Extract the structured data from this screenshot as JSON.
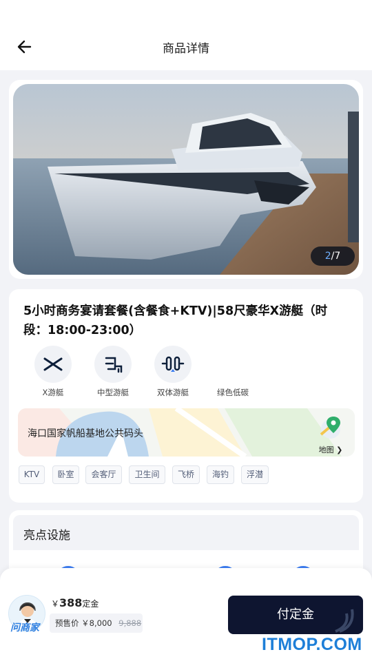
{
  "header": {
    "title": "商品详情",
    "back_icon": "arrow-left-icon"
  },
  "gallery": {
    "current": "2",
    "separator": "/",
    "total": "7"
  },
  "product": {
    "title": "5小时商务宴请套餐(含餐食+KTV)|58尺豪华X游艇（时段：18:00-23:00）",
    "features": [
      {
        "icon": "x-logo-icon",
        "label": "X游艇"
      },
      {
        "icon": "mid-yacht-icon",
        "label": "中型游艇"
      },
      {
        "icon": "twin-hull-icon",
        "label": "双体游艇"
      },
      {
        "icon": "",
        "label": "绿色低碳"
      }
    ],
    "location": {
      "text": "海口国家帆船基地公共码头",
      "map_label": "地图 ❯"
    },
    "tags": [
      "KTV",
      "卧室",
      "会客厅",
      "卫生间",
      "飞桥",
      "海钓",
      "浮潜"
    ]
  },
  "highlights": {
    "title": "亮点设施"
  },
  "footer": {
    "ask_label": "问商家",
    "deposit_currency": "￥",
    "deposit_amount": "388",
    "deposit_unit": "定金",
    "presale_label": "预售价",
    "presale_price": "￥8,000",
    "original_price": "9,888",
    "pay_button": "付定金"
  },
  "watermark": "ITMOP.COM",
  "colors": {
    "accent": "#3b7cf0",
    "button_bg": "#0e1530",
    "watermark": "#1e7fd8"
  }
}
